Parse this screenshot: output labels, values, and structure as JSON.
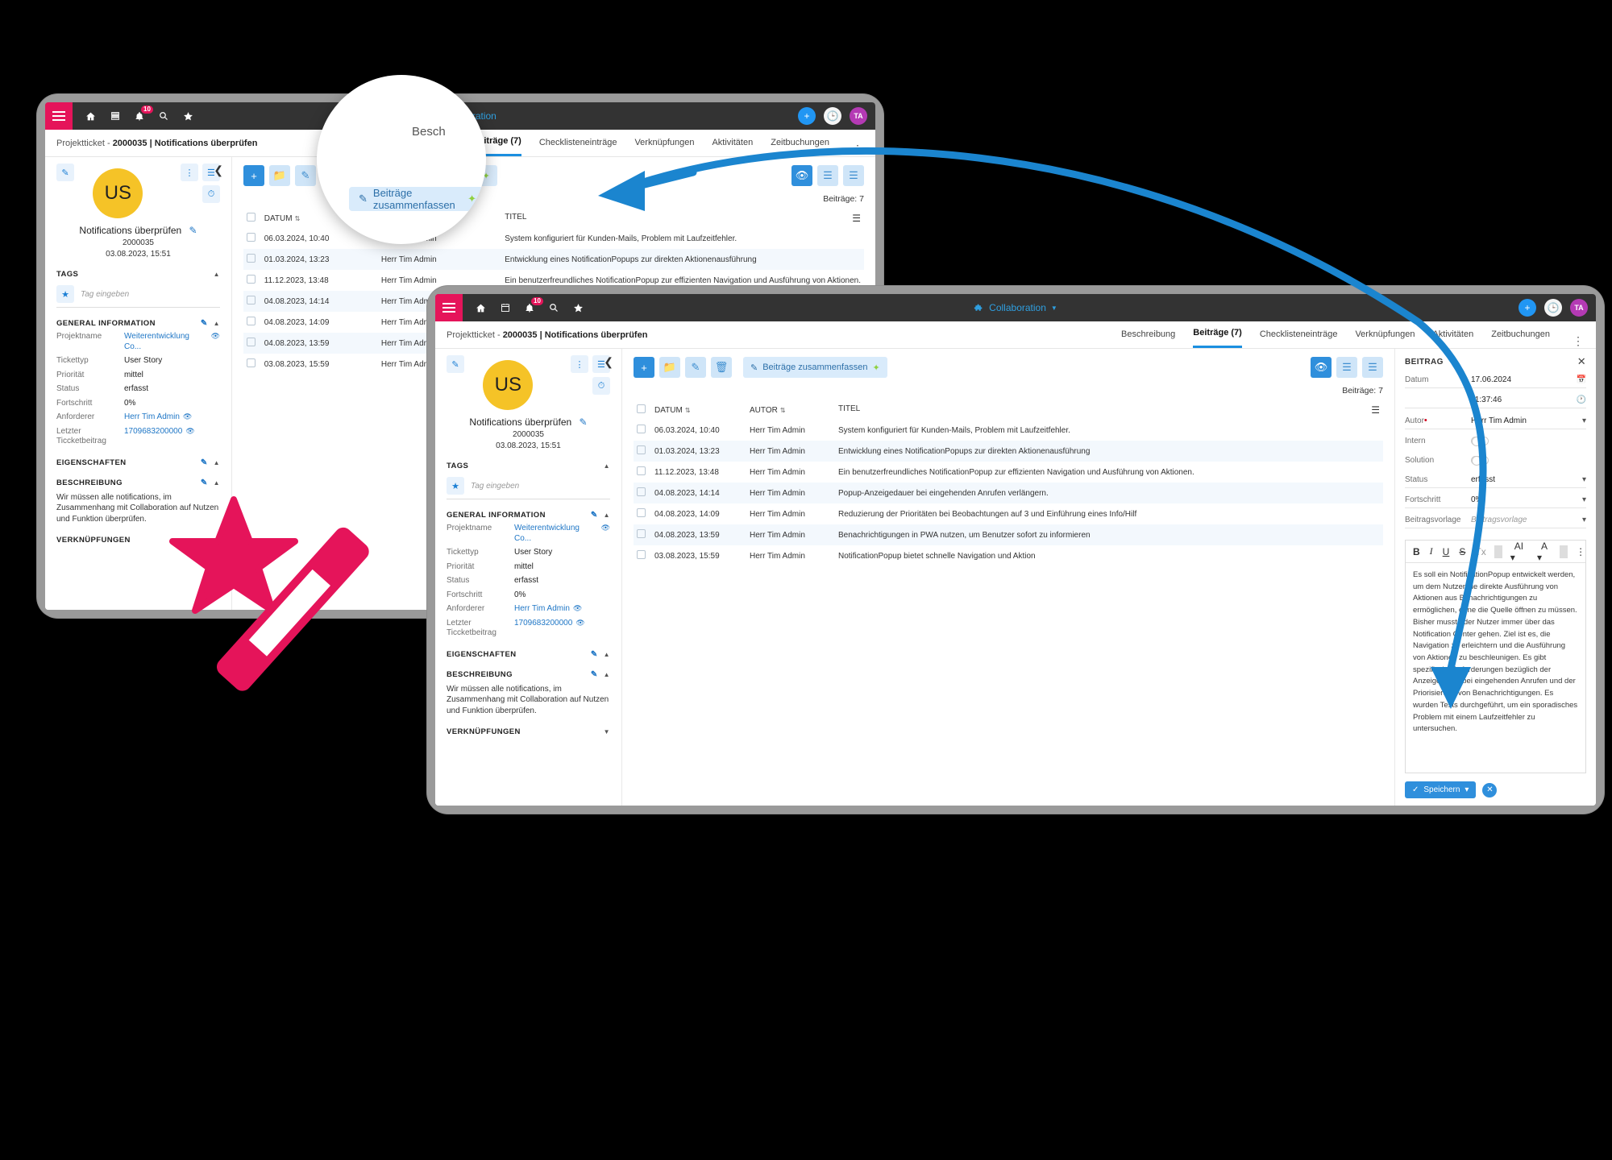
{
  "nav": {
    "menu_icon": "hamburger-icon",
    "icons": [
      "home-icon",
      "calendar-icon",
      "bell-icon",
      "search-icon",
      "star-icon"
    ],
    "notification_count": "10",
    "app_label": "Collaboration",
    "add_label": "+",
    "history_icon": "history-icon",
    "avatar_initials": "TA"
  },
  "breadcrumb": {
    "prefix": "Projektticket - ",
    "value": "2000035 | Notifications überprüfen"
  },
  "tabs": [
    {
      "label": "Beschreibung",
      "active": false
    },
    {
      "label": "Beiträge (7)",
      "active": true
    },
    {
      "label": "Checklisteneinträge",
      "active": false
    },
    {
      "label": "Verknüpfungen",
      "active": false
    },
    {
      "label": "Aktivitäten",
      "active": false
    },
    {
      "label": "Zeitbuchungen",
      "active": false
    }
  ],
  "ticket": {
    "avatar_initials": "US",
    "title": "Notifications überprüfen",
    "number": "2000035",
    "created": "03.08.2023, 15:51",
    "tags_heading": "TAGS",
    "tag_placeholder": "Tag eingeben",
    "general_heading": "GENERAL INFORMATION",
    "fields": [
      {
        "label": "Projektname",
        "value": "Weiterentwicklung Co...",
        "link": true,
        "eye": true
      },
      {
        "label": "Tickettyp",
        "value": "User Story",
        "link": false,
        "eye": false
      },
      {
        "label": "Priorität",
        "value": "mittel",
        "link": false,
        "eye": false
      },
      {
        "label": "Status",
        "value": "erfasst",
        "link": false,
        "eye": false
      },
      {
        "label": "Fortschritt",
        "value": "0%",
        "link": false,
        "eye": false
      },
      {
        "label": "Anforderer",
        "value": "Herr Tim Admin",
        "link": true,
        "eye": true
      },
      {
        "label": "Letzter Ticcketbeitrag",
        "value": "1709683200000",
        "link": true,
        "eye": true
      }
    ],
    "eigenschaften_heading": "EIGENSCHAFTEN",
    "beschreibung_heading": "BESCHREIBUNG",
    "beschreibung_text": "Wir müssen alle notifications, im Zusammenhang mit Collaboration auf Nutzen und Funktion überprüfen.",
    "verknuepfungen_heading": "VERKNÜPFUNGEN"
  },
  "toolbar": {
    "add": "+",
    "folder_icon": "folder-icon",
    "edit_icon": "pencil-icon",
    "delete_icon": "trash-icon",
    "summarize_label": "Beiträge zusammenfassen",
    "summarize_icon": "summarize-icon",
    "ai_icon": "magic-wand-icon",
    "view_icon": "eye-icon",
    "filter_icon": "filter-icon",
    "list_icon": "list-icon",
    "count_label": "Beiträge: 7"
  },
  "table": {
    "columns": [
      "DATUM",
      "AUTOR",
      "TITEL"
    ],
    "rows": [
      {
        "datum": "06.03.2024, 10:40",
        "autor": "Herr Tim Admin",
        "titel": "System konfiguriert für Kunden-Mails, Problem mit Laufzeitfehler."
      },
      {
        "datum": "01.03.2024, 13:23",
        "autor": "Herr Tim Admin",
        "titel": "Entwicklung eines NotificationPopups zur direkten Aktionenausführung"
      },
      {
        "datum": "11.12.2023, 13:48",
        "autor": "Herr Tim Admin",
        "titel": "Ein benutzerfreundliches NotificationPopup zur effizienten Navigation und Ausführung von Aktionen."
      },
      {
        "datum": "04.08.2023, 14:14",
        "autor": "Herr Tim Admin",
        "titel": "Popup-Anzeigedauer bei eingehenden Anrufen verlängern."
      },
      {
        "datum": "04.08.2023, 14:09",
        "autor": "Herr Tim Admin",
        "titel": "Reduzierung der Prioritäten bei Beobachtungen auf 3 und Einführung eines Info/Hilf"
      },
      {
        "datum": "04.08.2023, 13:59",
        "autor": "Herr Tim Admin",
        "titel": "Benachrichtigungen in PWA nutzen, um Benutzer sofort zu informieren"
      },
      {
        "datum": "03.08.2023, 15:59",
        "autor": "Herr Tim Admin",
        "titel": "NotificationPopup bietet schnelle Navigation und Aktion"
      }
    ]
  },
  "beitrag": {
    "heading": "BEITRAG",
    "close_icon": "close-icon",
    "date_label": "Datum",
    "date_value": "17.06.2024",
    "date_icon": "calendar-icon",
    "time_value": "11:37:46",
    "time_icon": "clock-icon",
    "autor_label": "Autor",
    "autor_value": "Herr Tim Admin",
    "intern_label": "Intern",
    "solution_label": "Solution",
    "status_label": "Status",
    "status_value": "erfasst",
    "fortschritt_label": "Fortschritt",
    "fortschritt_value": "0%",
    "vorlage_label": "Beitragsvorlage",
    "vorlage_placeholder": "Beitragsvorlage",
    "editor_tools": [
      "B",
      "I",
      "U",
      "S",
      "Tx",
      "AI",
      "A"
    ],
    "editor_text": "Es soll ein NotificationPopup entwickelt werden, um dem Nutzer die direkte Ausführung von Aktionen aus Benachrichtigungen zu ermöglichen, ohne die Quelle öffnen zu müssen. Bisher musste der Nutzer immer über das Notification Center gehen. Ziel ist es, die Navigation zu erleichtern und die Ausführung von Aktionen zu beschleunigen. Es gibt spezifische Anforderungen bezüglich der Anzeigedauer bei eingehenden Anrufen und der Priorisierung von Benachrichtigungen. Es wurden Tests durchgeführt, um ein sporadisches Problem mit einem Laufzeitfehler zu untersuchen.",
    "save_label": "Speichern",
    "cancel_icon": "cancel-icon"
  },
  "magnifier": {
    "app_label": "Collaboration",
    "tab_label": "Besch",
    "button_label": "Beiträge zusammenfassen"
  },
  "colors": {
    "brand_pink": "#e5145a",
    "accent_blue": "#2f8fdc",
    "arrow_blue": "#1b85cf",
    "avatar_yellow": "#f5c327",
    "avatar_purple": "#b43ab4"
  }
}
